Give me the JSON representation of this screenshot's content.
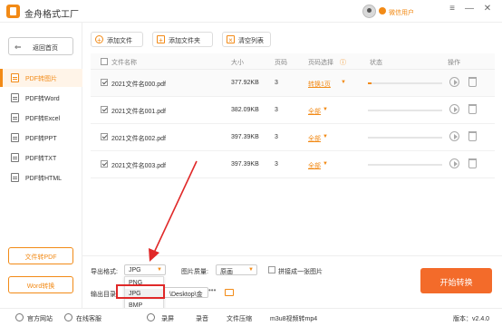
{
  "app": {
    "title": "金舟格式工厂",
    "user_label": "微信用户",
    "window_controls": [
      "≡",
      "—",
      "✕"
    ]
  },
  "sidebar": {
    "home_label": "返回首页",
    "items": [
      {
        "label": "PDF转图片",
        "active": true
      },
      {
        "label": "PDF转Word",
        "active": false
      },
      {
        "label": "PDF转Excel",
        "active": false
      },
      {
        "label": "PDF转PPT",
        "active": false
      },
      {
        "label": "PDF转TXT",
        "active": false
      },
      {
        "label": "PDF转HTML",
        "active": false
      }
    ],
    "bottom_buttons": [
      "文件转PDF",
      "Word转换"
    ]
  },
  "toolbar": {
    "add_file": "添加文件",
    "add_folder": "添加文件夹",
    "clear_list": "清空列表"
  },
  "table": {
    "headers": {
      "name": "文件名称",
      "size": "大小",
      "pages": "页码",
      "page_select": "页码选择",
      "status": "状态",
      "action": "操作"
    },
    "rows": [
      {
        "name": "2021文件名000.pdf",
        "size": "377.92KB",
        "pages": "3",
        "page_select": "转换1页",
        "progress": 0.05
      },
      {
        "name": "2021文件名001.pdf",
        "size": "382.09KB",
        "pages": "3",
        "page_select": "全部",
        "progress": 0
      },
      {
        "name": "2021文件名002.pdf",
        "size": "397.39KB",
        "pages": "3",
        "page_select": "全部",
        "progress": 0
      },
      {
        "name": "2021文件名003.pdf",
        "size": "397.39KB",
        "pages": "3",
        "page_select": "全部",
        "progress": 0
      }
    ]
  },
  "settings": {
    "format_label": "导出格式:",
    "format_value": "JPG",
    "format_options": [
      "PNG",
      "JPG",
      "BMP"
    ],
    "quality_label": "图片质量:",
    "quality_value": "原画",
    "merge_label": "拼接成一张图片",
    "output_label": "输出目录:",
    "output_path": "\\Desktop\\金",
    "start_button": "开始转换"
  },
  "statusbar": {
    "items": [
      "官方网站",
      "在线客服",
      "录屏",
      "录音",
      "文件压缩",
      "m3u8视频转mp4"
    ],
    "version": "版本：v2.4.0"
  },
  "colors": {
    "accent": "#f28a16",
    "start_button": "#f36b2a",
    "annotation": "#e02828"
  }
}
